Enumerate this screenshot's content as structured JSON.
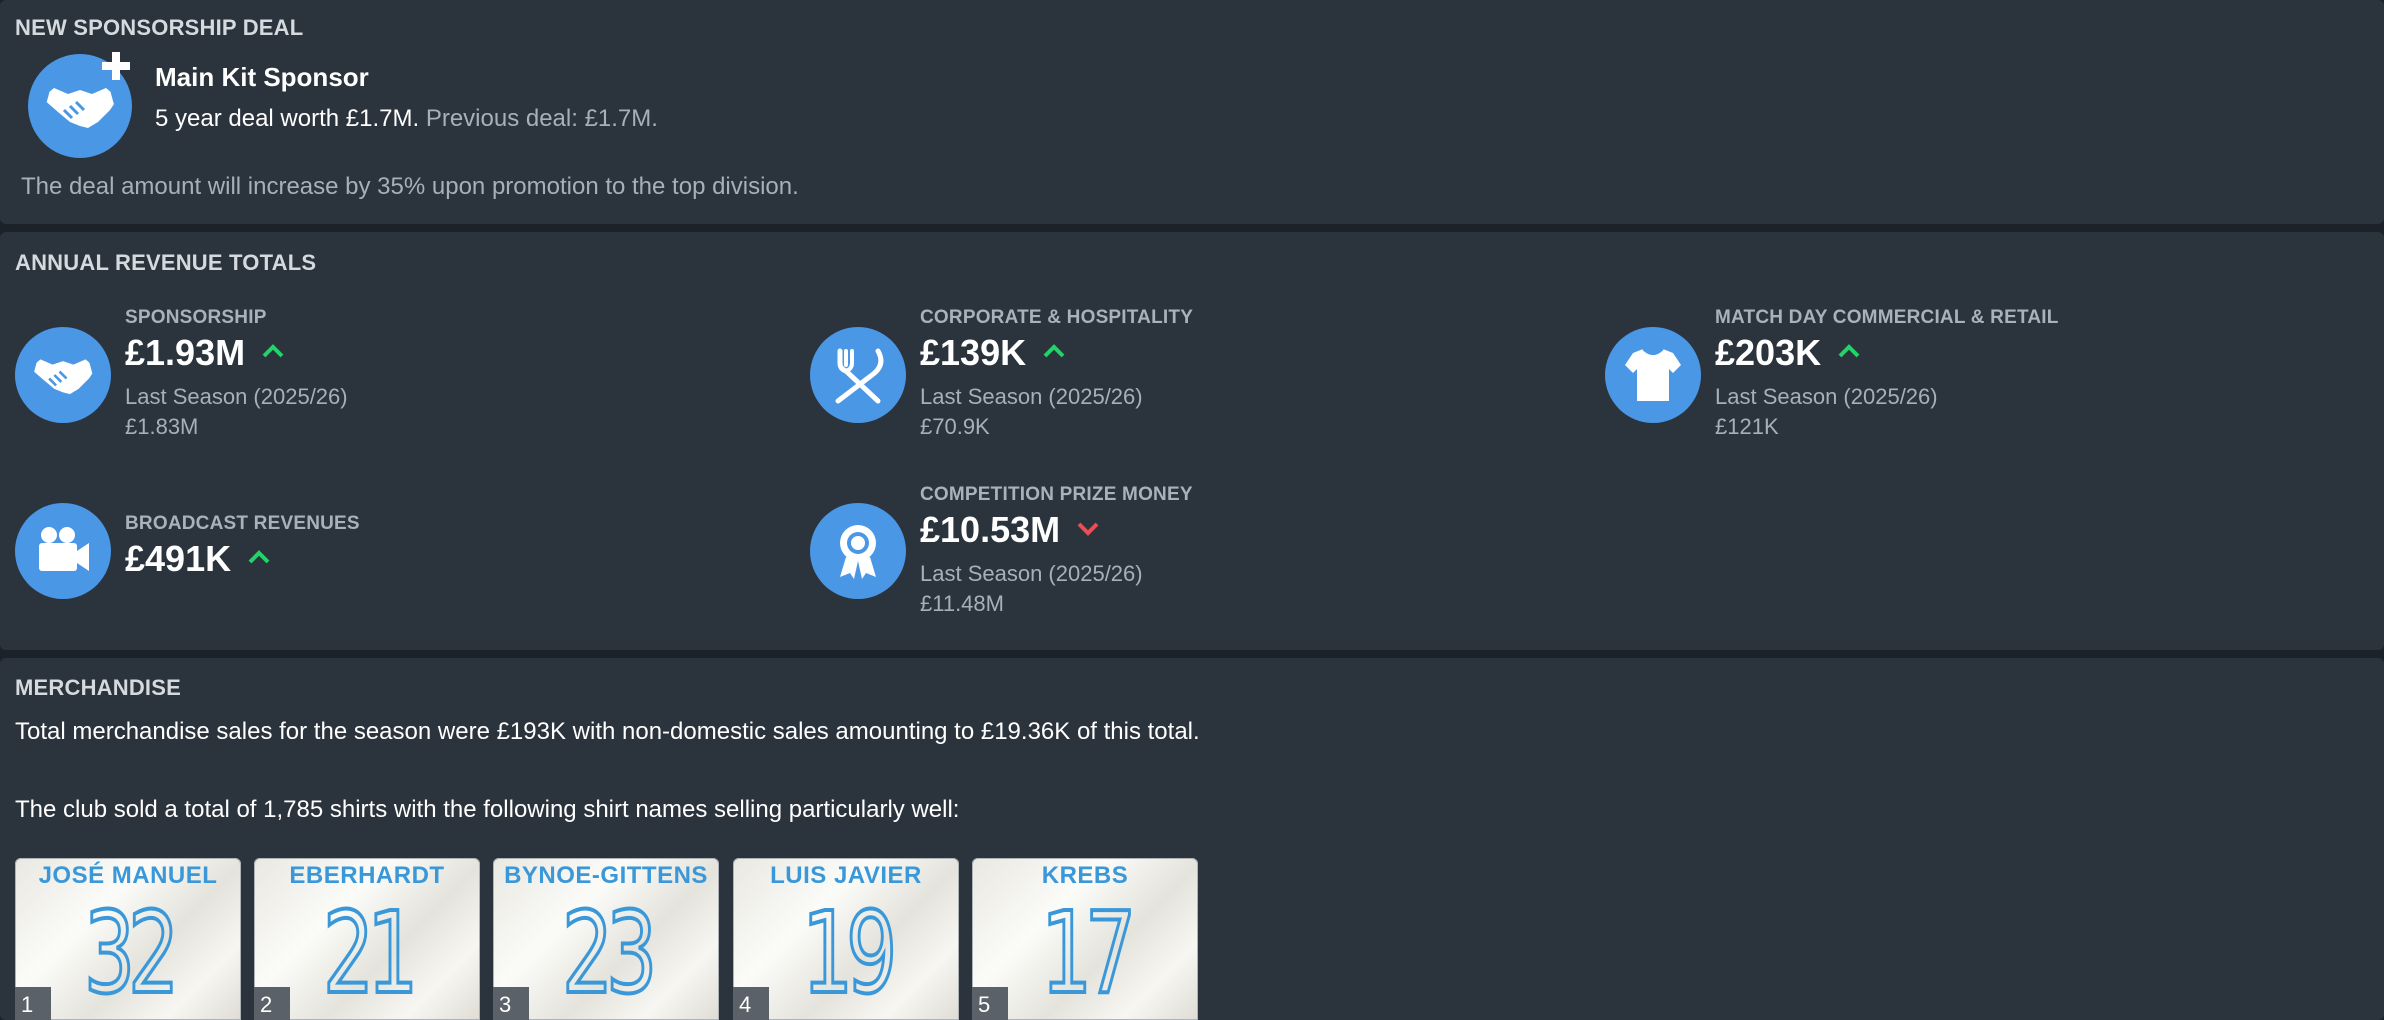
{
  "sponsorship_deal": {
    "section_title": "NEW SPONSORSHIP DEAL",
    "title": "Main Kit Sponsor",
    "deal_text": "5 year deal worth £1.7M.",
    "previous_text": "Previous deal: £1.7M.",
    "note": "The deal amount will increase by 35% upon promotion to the top division."
  },
  "revenue": {
    "section_title": "ANNUAL REVENUE TOTALS",
    "items": [
      {
        "label": "SPONSORSHIP",
        "value": "£1.93M",
        "trend": "up",
        "last_label": "Last Season (2025/26)",
        "last_value": "£1.83M",
        "icon": "handshake-icon"
      },
      {
        "label": "CORPORATE & HOSPITALITY",
        "value": "£139K",
        "trend": "up",
        "last_label": "Last Season (2025/26)",
        "last_value": "£70.9K",
        "icon": "cutlery-icon"
      },
      {
        "label": "MATCH DAY COMMERCIAL & RETAIL",
        "value": "£203K",
        "trend": "up",
        "last_label": "Last Season (2025/26)",
        "last_value": "£121K",
        "icon": "shirt-icon"
      },
      {
        "label": "BROADCAST REVENUES",
        "value": "£491K",
        "trend": "up",
        "icon": "camera-icon"
      },
      {
        "label": "COMPETITION PRIZE MONEY",
        "value": "£10.53M",
        "trend": "down",
        "last_label": "Last Season (2025/26)",
        "last_value": "£11.48M",
        "icon": "medal-icon"
      }
    ]
  },
  "merchandise": {
    "section_title": "MERCHANDISE",
    "summary": "Total merchandise sales for the season were £193K with non-domestic sales amounting to £19.36K of this total.",
    "shirts_text": "The club sold a total of 1,785 shirts with the following shirt names selling particularly well:",
    "shirts": [
      {
        "rank": "1",
        "name": "JOSÉ MANUEL",
        "number": "32"
      },
      {
        "rank": "2",
        "name": "EBERHARDT",
        "number": "21"
      },
      {
        "rank": "3",
        "name": "BYNOE-GITTENS",
        "number": "23"
      },
      {
        "rank": "4",
        "name": "LUIS JAVIER",
        "number": "19"
      },
      {
        "rank": "5",
        "name": "KREBS",
        "number": "17"
      }
    ]
  },
  "colors": {
    "background": "#2b333c",
    "icon_circle": "#4a97e6",
    "trend_up": "#22d36a",
    "trend_down": "#ee4d55",
    "shirt_print": "#3a98d9"
  }
}
